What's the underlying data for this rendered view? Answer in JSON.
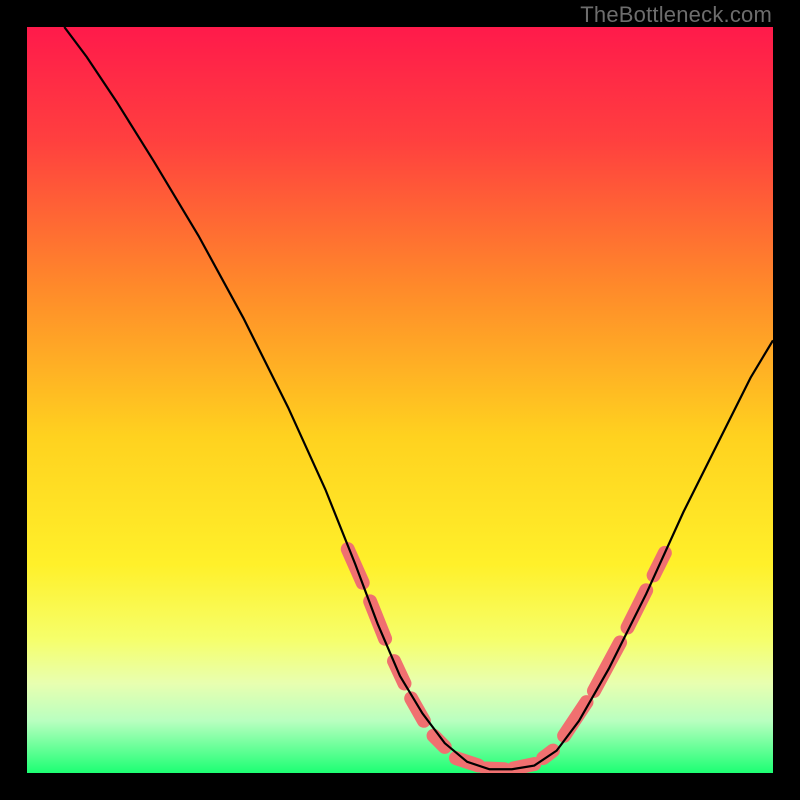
{
  "watermark": "TheBottleneck.com",
  "chart_data": {
    "type": "line",
    "title": "",
    "xlabel": "",
    "ylabel": "",
    "xlim": [
      0,
      1
    ],
    "ylim": [
      0,
      1
    ],
    "background_gradient": {
      "stops": [
        {
          "offset": 0.0,
          "color": "#ff1a4b"
        },
        {
          "offset": 0.15,
          "color": "#ff3f3f"
        },
        {
          "offset": 0.35,
          "color": "#ff8a2a"
        },
        {
          "offset": 0.55,
          "color": "#ffd21f"
        },
        {
          "offset": 0.72,
          "color": "#fff02a"
        },
        {
          "offset": 0.82,
          "color": "#f6ff6a"
        },
        {
          "offset": 0.88,
          "color": "#e8ffb0"
        },
        {
          "offset": 0.93,
          "color": "#b9ffc0"
        },
        {
          "offset": 1.0,
          "color": "#1cff73"
        }
      ]
    },
    "series": [
      {
        "name": "bottleneck-curve",
        "type": "line",
        "color": "#000000",
        "points": [
          {
            "x": 0.05,
            "y": 1.0
          },
          {
            "x": 0.08,
            "y": 0.96
          },
          {
            "x": 0.12,
            "y": 0.9
          },
          {
            "x": 0.17,
            "y": 0.82
          },
          {
            "x": 0.23,
            "y": 0.72
          },
          {
            "x": 0.29,
            "y": 0.61
          },
          {
            "x": 0.35,
            "y": 0.49
          },
          {
            "x": 0.4,
            "y": 0.38
          },
          {
            "x": 0.44,
            "y": 0.28
          },
          {
            "x": 0.47,
            "y": 0.2
          },
          {
            "x": 0.5,
            "y": 0.13
          },
          {
            "x": 0.53,
            "y": 0.08
          },
          {
            "x": 0.56,
            "y": 0.04
          },
          {
            "x": 0.59,
            "y": 0.015
          },
          {
            "x": 0.62,
            "y": 0.005
          },
          {
            "x": 0.65,
            "y": 0.005
          },
          {
            "x": 0.68,
            "y": 0.01
          },
          {
            "x": 0.71,
            "y": 0.03
          },
          {
            "x": 0.74,
            "y": 0.07
          },
          {
            "x": 0.78,
            "y": 0.14
          },
          {
            "x": 0.83,
            "y": 0.24
          },
          {
            "x": 0.88,
            "y": 0.35
          },
          {
            "x": 0.93,
            "y": 0.45
          },
          {
            "x": 0.97,
            "y": 0.53
          },
          {
            "x": 1.0,
            "y": 0.58
          }
        ]
      },
      {
        "name": "highlight-segments",
        "type": "line",
        "color": "#f07070",
        "stroke_width": 14,
        "dash": true,
        "segments": [
          [
            {
              "x": 0.43,
              "y": 0.3
            },
            {
              "x": 0.45,
              "y": 0.255
            }
          ],
          [
            {
              "x": 0.46,
              "y": 0.23
            },
            {
              "x": 0.48,
              "y": 0.18
            }
          ],
          [
            {
              "x": 0.492,
              "y": 0.15
            },
            {
              "x": 0.506,
              "y": 0.12
            }
          ],
          [
            {
              "x": 0.515,
              "y": 0.1
            },
            {
              "x": 0.532,
              "y": 0.07
            }
          ],
          [
            {
              "x": 0.545,
              "y": 0.05
            },
            {
              "x": 0.56,
              "y": 0.035
            }
          ],
          [
            {
              "x": 0.575,
              "y": 0.02
            },
            {
              "x": 0.605,
              "y": 0.01
            }
          ],
          [
            {
              "x": 0.615,
              "y": 0.006
            },
            {
              "x": 0.64,
              "y": 0.005
            }
          ],
          [
            {
              "x": 0.652,
              "y": 0.006
            },
            {
              "x": 0.68,
              "y": 0.012
            }
          ],
          [
            {
              "x": 0.692,
              "y": 0.02
            },
            {
              "x": 0.705,
              "y": 0.03
            }
          ],
          [
            {
              "x": 0.72,
              "y": 0.05
            },
            {
              "x": 0.75,
              "y": 0.095
            }
          ],
          [
            {
              "x": 0.76,
              "y": 0.11
            },
            {
              "x": 0.795,
              "y": 0.175
            }
          ],
          [
            {
              "x": 0.805,
              "y": 0.195
            },
            {
              "x": 0.83,
              "y": 0.245
            }
          ],
          [
            {
              "x": 0.84,
              "y": 0.265
            },
            {
              "x": 0.855,
              "y": 0.295
            }
          ]
        ]
      }
    ]
  }
}
